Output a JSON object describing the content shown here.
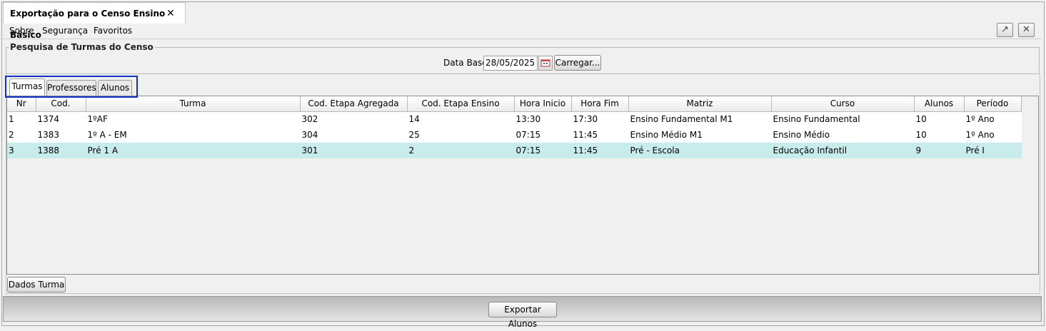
{
  "window": {
    "tab_title": "Exportação para o Censo Ensino Básico",
    "tab_close": "✕"
  },
  "menu": {
    "items": [
      "Sobre",
      "Segurança",
      "Favoritos"
    ]
  },
  "window_buttons": {
    "detach_icon": "↗",
    "close_icon": "✕"
  },
  "search": {
    "legend": "Pesquisa de Turmas do Censo",
    "date_label": "Data Base:",
    "date_value": "28/05/2025",
    "load_button": "Carregar..."
  },
  "tabs": [
    {
      "label": "Turmas",
      "active": true
    },
    {
      "label": "Professores",
      "active": false
    },
    {
      "label": "Alunos",
      "active": false
    }
  ],
  "grid": {
    "columns": [
      "Nr",
      "Cod.",
      "Turma",
      "Cod. Etapa Agregada",
      "Cod. Etapa Ensino",
      "Hora Inicio",
      "Hora Fim",
      "Matriz",
      "Curso",
      "Alunos",
      "Período"
    ],
    "rows": [
      [
        "1",
        "1374",
        "1ºAF",
        "302",
        "14",
        "13:30",
        "17:30",
        "Ensino Fundamental M1",
        "Ensino Fundamental",
        "10",
        "1º Ano"
      ],
      [
        "2",
        "1383",
        "1º A - EM",
        "304",
        "25",
        "07:15",
        "11:45",
        "Ensino Médio M1",
        "Ensino Médio",
        "10",
        "1º Ano"
      ],
      [
        "3",
        "1388",
        "Pré 1 A",
        "301",
        "2",
        "07:15",
        "11:45",
        "Pré - Escola",
        "Educação Infantil",
        "9",
        "Pré I"
      ]
    ],
    "selected_row": 2
  },
  "actions": {
    "details_button": "Dados Turma",
    "export_button": "Exportar Alunos"
  },
  "colors": {
    "selection": "#c8ebeb",
    "tab_highlight": "#1230c8"
  }
}
